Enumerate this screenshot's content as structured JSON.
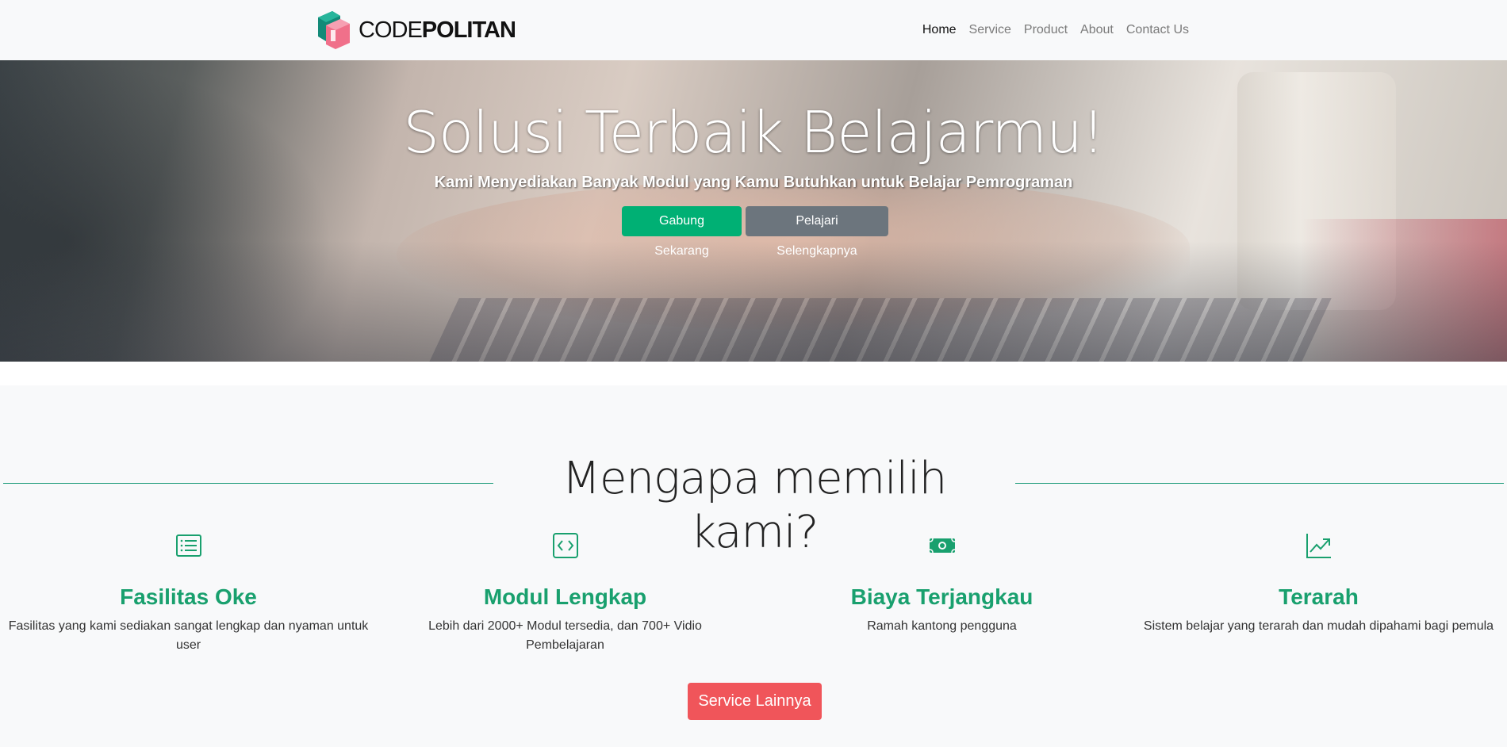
{
  "brand": {
    "name_light": "CODE",
    "name_bold": "POLITAN"
  },
  "nav": {
    "items": [
      {
        "label": "Home",
        "active": true
      },
      {
        "label": "Service"
      },
      {
        "label": "Product"
      },
      {
        "label": "About"
      },
      {
        "label": "Contact Us"
      }
    ]
  },
  "hero": {
    "title": "Solusi Terbaik Belajarmu!",
    "subtitle": "Kami Menyediakan Banyak Modul yang Kamu Butuhkan untuk Belajar Pemrograman",
    "primary_button": "Gabung Sekarang",
    "secondary_button": "Pelajari Selengkapnya"
  },
  "why": {
    "title": "Mengapa memilih kami?",
    "features": [
      {
        "icon": "list-icon",
        "title": "Fasilitas Oke",
        "text": "Fasilitas yang kami sediakan sangat lengkap dan nyaman untuk user"
      },
      {
        "icon": "code-square-icon",
        "title": "Modul Lengkap",
        "text": "Lebih dari 2000+ Modul tersedia, dan 700+ Vidio Pembelajaran"
      },
      {
        "icon": "cash-icon",
        "title": "Biaya Terjangkau",
        "text": "Ramah kantong pengguna"
      },
      {
        "icon": "graph-up-arrow-icon",
        "title": "Terarah",
        "text": "Sistem belajar yang terarah dan mudah dipahami bagi pemula"
      }
    ],
    "more_button": "Service Lainnya"
  },
  "colors": {
    "accent_green": "#19a06e",
    "success_button": "#00b074",
    "secondary_button": "#6c757d",
    "danger_button": "#f0555a",
    "divider": "#1e9c7a"
  }
}
